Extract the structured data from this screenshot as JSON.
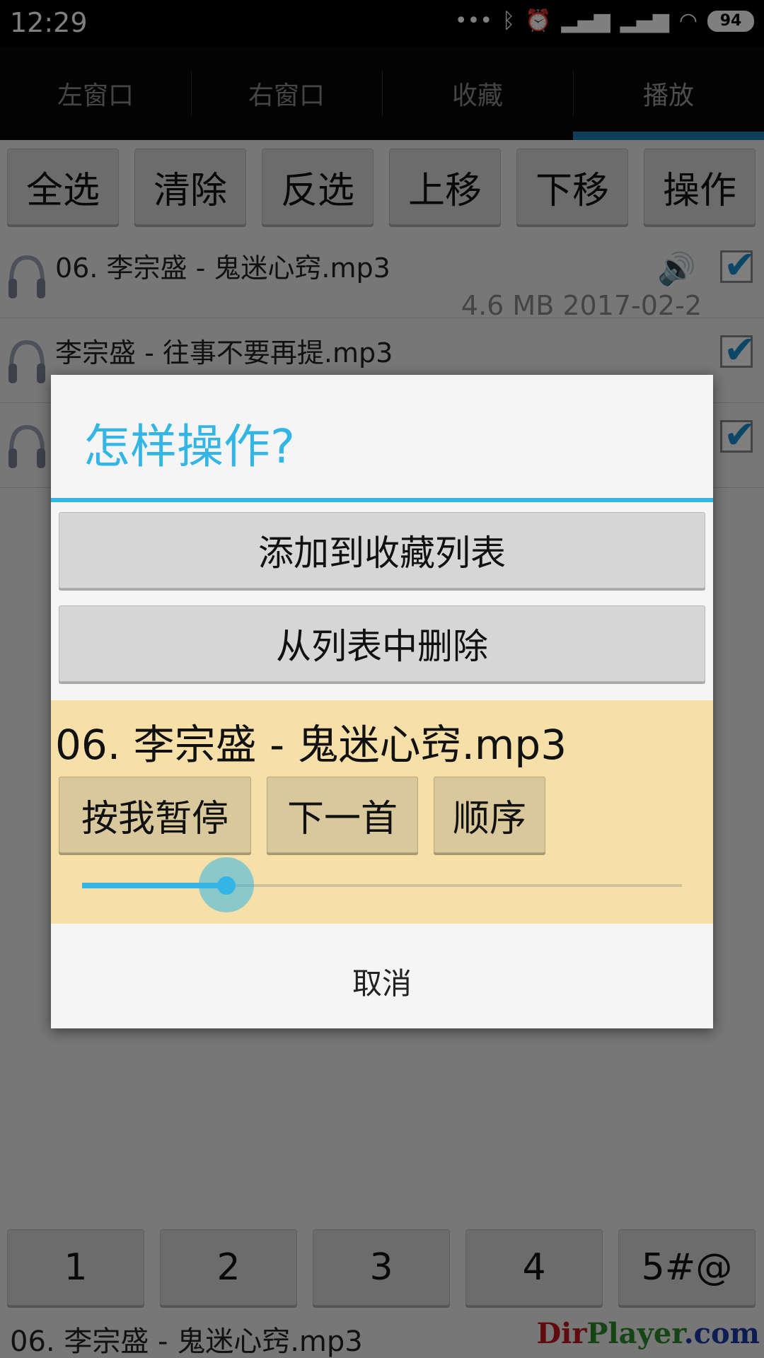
{
  "status_bar": {
    "time": "12:29",
    "battery": "94"
  },
  "tabs": [
    {
      "label": "左窗口"
    },
    {
      "label": "右窗口"
    },
    {
      "label": "收藏"
    },
    {
      "label": "播放"
    }
  ],
  "toolbar": [
    "全选",
    "清除",
    "反选",
    "上移",
    "下移",
    "操作"
  ],
  "files": [
    {
      "name": "06. 李宗盛 - 鬼迷心窍.mp3",
      "meta": "4.6 MB  2017-02-2"
    },
    {
      "name": "李宗盛 - 往事不要再提.mp3",
      "meta": ""
    },
    {
      "name": "",
      "meta": ""
    }
  ],
  "dialog": {
    "title": "怎样操作?",
    "add_to_favorites": "添加到收藏列表",
    "remove_from_list": "从列表中删除",
    "player": {
      "now_playing": "06. 李宗盛 - 鬼迷心窍.mp3",
      "pause": "按我暂停",
      "next": "下一首",
      "order": "顺序",
      "progress": 0.24
    },
    "cancel": "取消"
  },
  "bottom_keys": [
    "1",
    "2",
    "3",
    "4",
    "5#@"
  ],
  "bottom_status": "06. 李宗盛 - 鬼迷心窍.mp3",
  "watermark": {
    "part1": "Dir",
    "part2": "Player",
    "part3": ".com"
  }
}
